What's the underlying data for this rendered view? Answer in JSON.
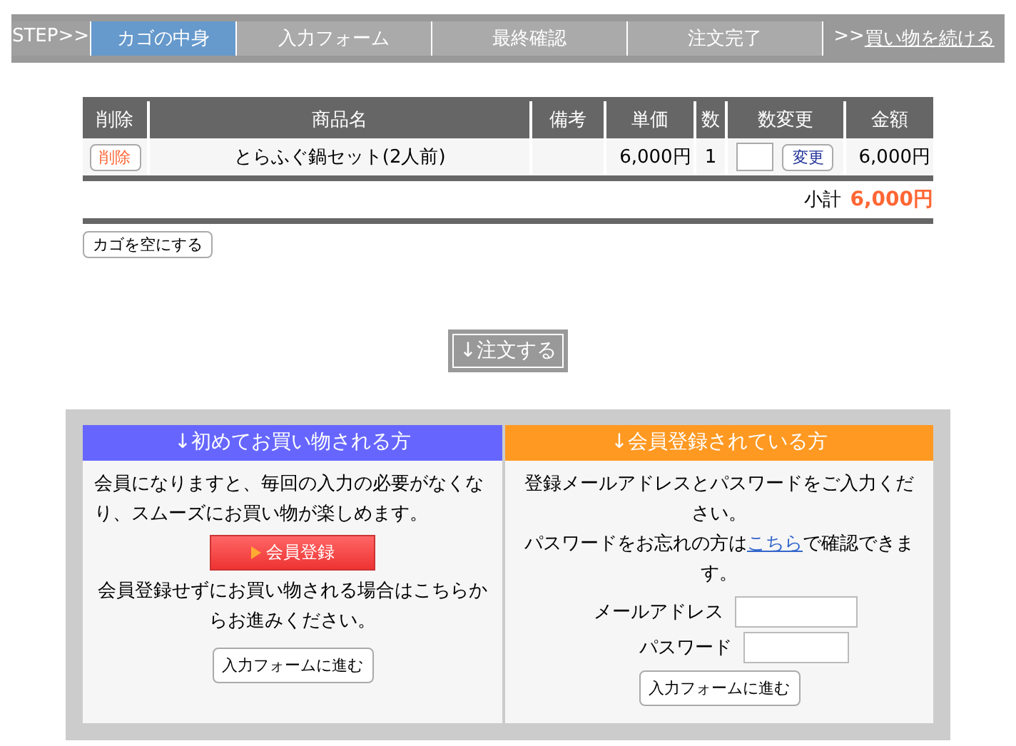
{
  "step_bar": {
    "label": "STEP>>",
    "steps": [
      {
        "label": "カゴの中身",
        "selected": true
      },
      {
        "label": "入力フォーム",
        "selected": false
      },
      {
        "label": "最終確認",
        "selected": false
      },
      {
        "label": "注文完了",
        "selected": false
      }
    ],
    "continue_link": {
      "prefix": ">>",
      "label": "買い物を続ける"
    }
  },
  "cart": {
    "columns": [
      "削除",
      "商品名",
      "備考",
      "単価",
      "数",
      "数変更",
      "金額"
    ],
    "rows": [
      {
        "delete_button": "削除",
        "name": "とらふぐ鍋セット(2人前)",
        "note": "",
        "unit_price": "6,000円",
        "quantity": "1",
        "change_button": "変更",
        "amount": "6,000円"
      }
    ],
    "subtotal_label": "小計",
    "subtotal": "6,000円",
    "empty_button": "カゴを空にする"
  },
  "order_button": "↓注文する",
  "new_customer": {
    "heading": "↓初めてお買い物される方",
    "text": "会員になりますと、毎回の入力の必要がなくなり、スムーズにお買い物が楽しめます。",
    "register_button": "会員登録",
    "guest_text": "会員登録せずにお買い物される場合はこちらからお進みください。",
    "proceed_button": "入力フォームに進む"
  },
  "member": {
    "heading": "↓会員登録されている方",
    "text": "登録メールアドレスとパスワードをご入力ください。",
    "forgot_before": "パスワードをお忘れの方は",
    "forgot_link": "こちら",
    "forgot_after": "で確認できます。",
    "email_label": "メールアドレス",
    "password_label": "パスワード",
    "proceed_button": "入力フォームに進む"
  }
}
